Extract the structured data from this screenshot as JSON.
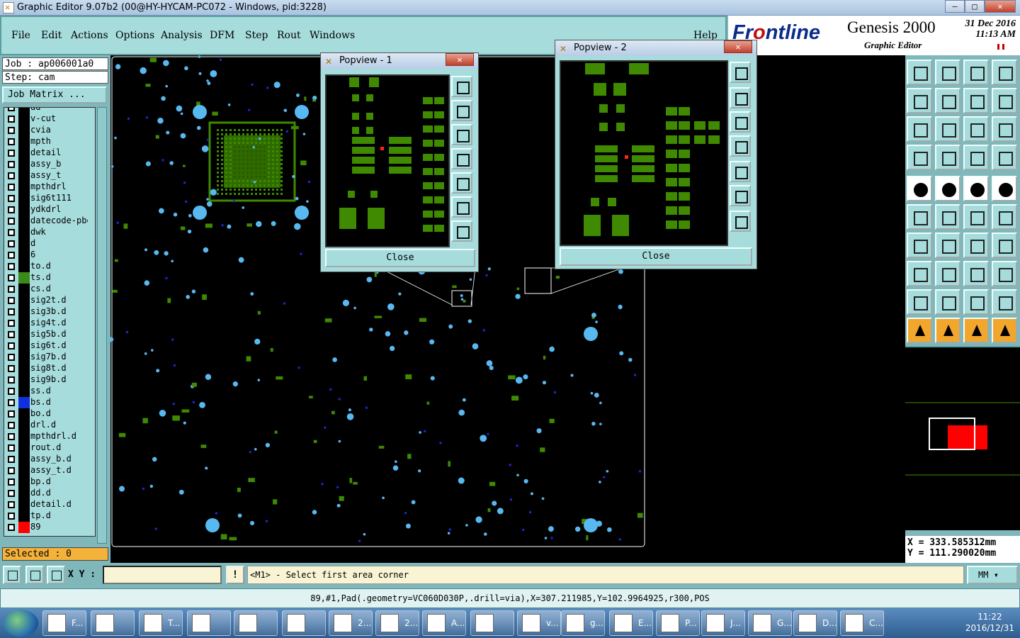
{
  "window": {
    "title": "Graphic Editor 9.07b2 (00@HY-HYCAM-PC072 - Windows, pid:3228)"
  },
  "menu": [
    "File",
    "Edit",
    "Actions",
    "Options",
    "Analysis",
    "DFM",
    "Step",
    "Rout",
    "Windows"
  ],
  "help": "Help",
  "brand": {
    "logo_pre": "Fr",
    "logo_accent": "o",
    "logo_post": "ntline",
    "product": "Genesis 2000",
    "subtitle": "Graphic Editor",
    "date": "31 Dec 2016",
    "time": "11:13 AM"
  },
  "job": {
    "job_label": "Job : ap006001a0",
    "step_label": "Step: cam",
    "matrix_button": "Job Matrix ..."
  },
  "layers": [
    {
      "name": "dd",
      "color": "#000000"
    },
    {
      "name": "v-cut",
      "color": "#000000"
    },
    {
      "name": "cvia",
      "color": "#000000"
    },
    {
      "name": "mpth",
      "color": "#000000"
    },
    {
      "name": "detail",
      "color": "#000000"
    },
    {
      "name": "assy_b",
      "color": "#000000"
    },
    {
      "name": "assy_t",
      "color": "#000000"
    },
    {
      "name": "mpthdrl",
      "color": "#000000"
    },
    {
      "name": "sig6t111",
      "color": "#000000"
    },
    {
      "name": "ydkdrl",
      "color": "#000000"
    },
    {
      "name": "datecode-pbe",
      "color": "#000000"
    },
    {
      "name": "dwk",
      "color": "#000000"
    },
    {
      "name": "d",
      "color": "#000000"
    },
    {
      "name": "6",
      "color": "#000000"
    },
    {
      "name": "to.d",
      "color": "#000000"
    },
    {
      "name": "ts.d",
      "color": "#3a8a1a"
    },
    {
      "name": "cs.d",
      "color": "#000000"
    },
    {
      "name": "sig2t.d",
      "color": "#000000"
    },
    {
      "name": "sig3b.d",
      "color": "#000000"
    },
    {
      "name": "sig4t.d",
      "color": "#000000"
    },
    {
      "name": "sig5b.d",
      "color": "#000000"
    },
    {
      "name": "sig6t.d",
      "color": "#000000"
    },
    {
      "name": "sig7b.d",
      "color": "#000000"
    },
    {
      "name": "sig8t.d",
      "color": "#000000"
    },
    {
      "name": "sig9b.d",
      "color": "#000000"
    },
    {
      "name": "ss.d",
      "color": "#000000"
    },
    {
      "name": "bs.d",
      "color": "#1030e0"
    },
    {
      "name": "bo.d",
      "color": "#000000"
    },
    {
      "name": "drl.d",
      "color": "#000000"
    },
    {
      "name": "mpthdrl.d",
      "color": "#000000"
    },
    {
      "name": "rout.d",
      "color": "#000000"
    },
    {
      "name": "assy_b.d",
      "color": "#000000"
    },
    {
      "name": "assy_t.d",
      "color": "#000000"
    },
    {
      "name": "bp.d",
      "color": "#000000"
    },
    {
      "name": "dd.d",
      "color": "#000000"
    },
    {
      "name": "detail.d",
      "color": "#000000"
    },
    {
      "name": "tp.d",
      "color": "#000000"
    },
    {
      "name": "89",
      "color": "#ff0000"
    }
  ],
  "selected": "Selected : 0",
  "popup1": {
    "title": "Popview - 1",
    "close": "Close"
  },
  "popup2": {
    "title": "Popview - 2",
    "close": "Close"
  },
  "coords": {
    "x": "X = 333.585312mm",
    "y": "Y = 111.290020mm"
  },
  "command": {
    "xy_label": "X Y :",
    "prompt": "<M1> - Select first area corner",
    "units": "MM",
    "excl": "!"
  },
  "status": "89,#1,Pad(.geometry=VC060D030P,.drill=via),X=307.211985,Y=102.9964925,r300,POS",
  "taskbar": {
    "items": [
      "F...",
      "",
      "T...",
      "",
      "",
      "",
      "2...",
      "2...",
      "A...",
      "",
      "v...",
      "g...",
      "E...",
      "P...",
      "J...",
      "G...",
      "D...",
      "C..."
    ],
    "clock_time": "11:22",
    "clock_date": "2016/12/31"
  },
  "colors": {
    "green": "#3f8a00",
    "blue": "#58b8f0",
    "darkblue": "#1a2ad8",
    "panel": "#a7dcdd"
  }
}
